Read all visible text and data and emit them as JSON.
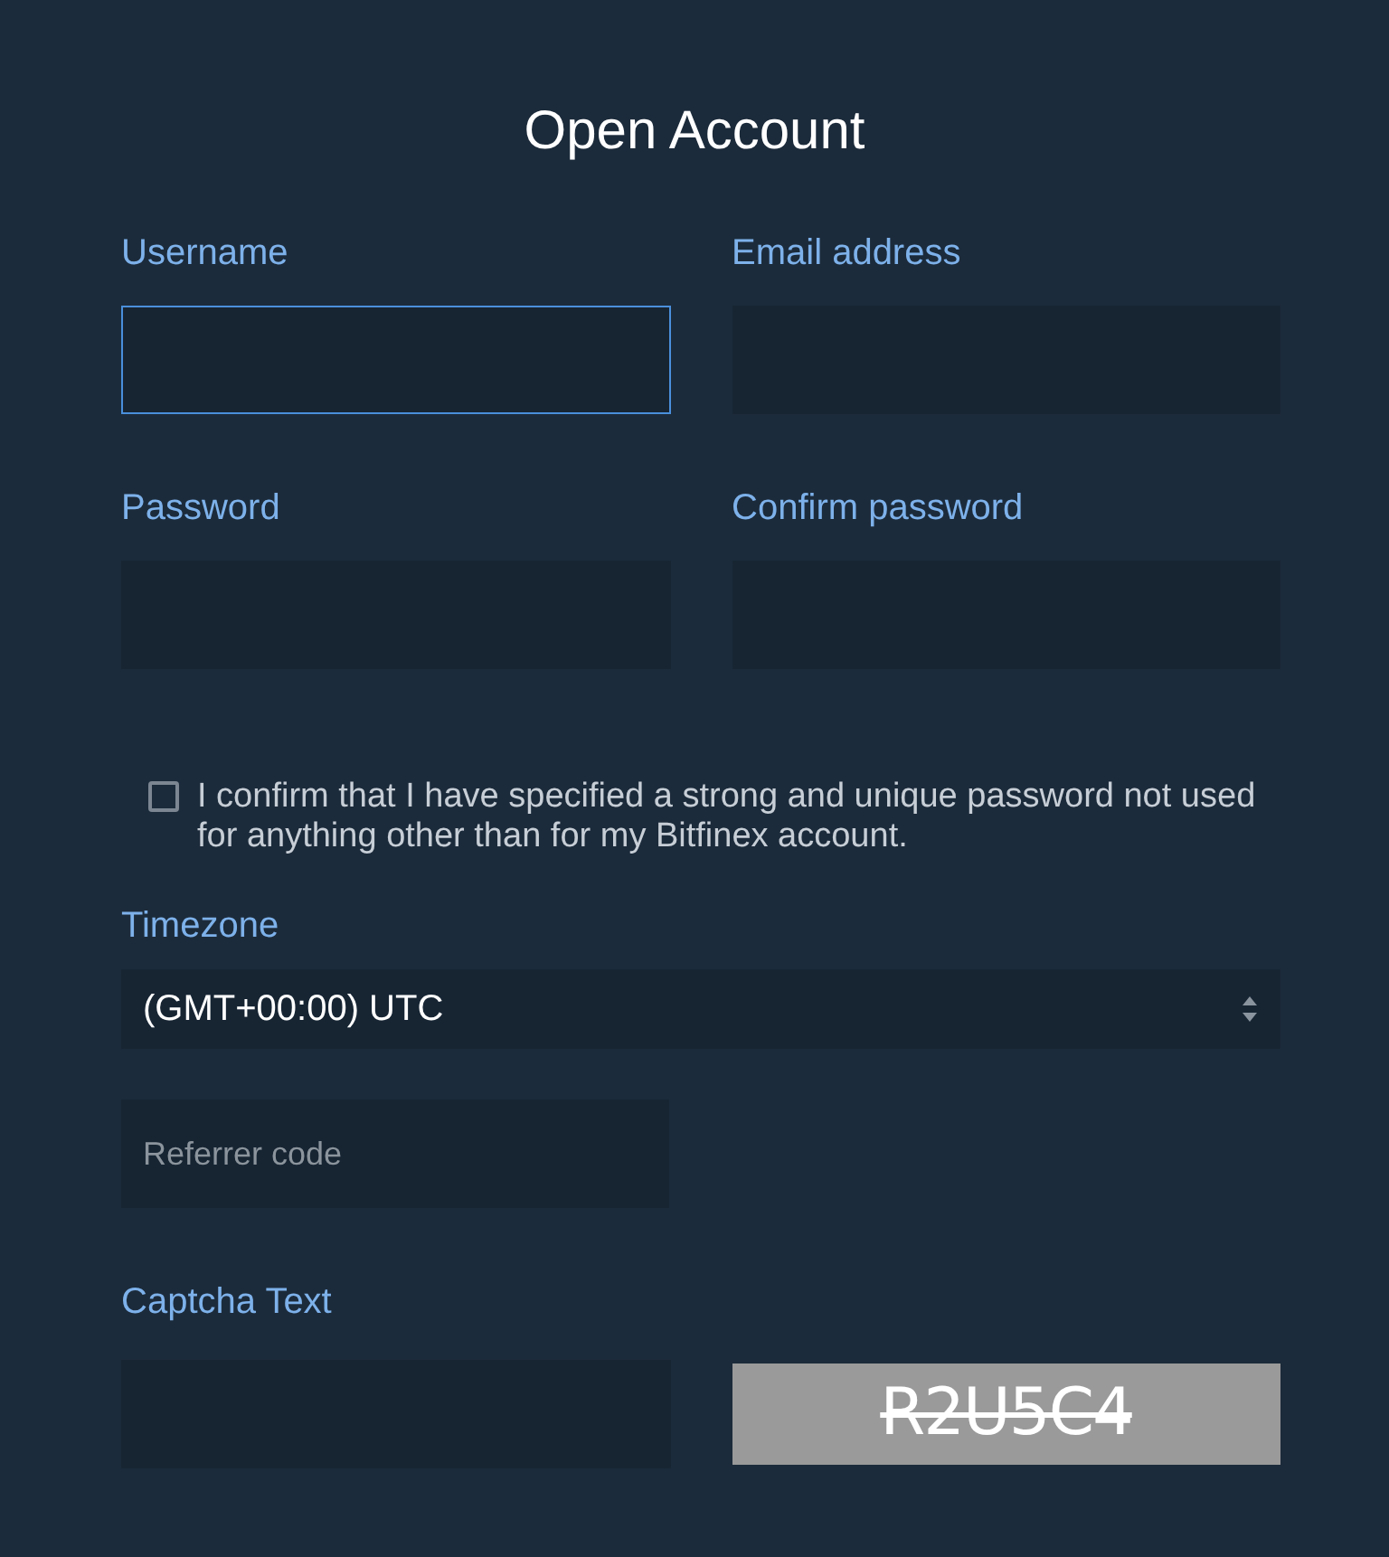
{
  "title": "Open Account",
  "fields": [
    {
      "label": "Username",
      "focused": true
    },
    {
      "label": "Email address",
      "focused": false
    },
    {
      "label": "Password",
      "focused": false
    },
    {
      "label": "Confirm password",
      "focused": false
    }
  ],
  "confirm": {
    "checked": false,
    "text": "I confirm that I have specified a strong and unique password not used for anything other than for my Bitfinex account."
  },
  "timezone": {
    "label": "Timezone",
    "value": "(GMT+00:00) UTC"
  },
  "referrer": {
    "placeholder": "Referrer code"
  },
  "captcha": {
    "label": "Captcha Text",
    "image_text": "R2U5C4"
  }
}
